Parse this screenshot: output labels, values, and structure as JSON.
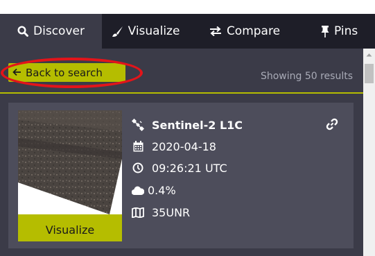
{
  "tabs": [
    {
      "label": "Discover",
      "icon": "search-icon",
      "active": true
    },
    {
      "label": "Visualize",
      "icon": "brush-icon",
      "active": false
    },
    {
      "label": "Compare",
      "icon": "swap-arrows-icon",
      "active": false
    },
    {
      "label": "Pins",
      "icon": "pin-icon",
      "active": false
    }
  ],
  "results": {
    "back_label": "Back to search",
    "count_text": "Showing 50 results"
  },
  "card": {
    "satellite": "Sentinel-2 L1C",
    "date": "2020-04-18",
    "time": "09:26:21 UTC",
    "cloud_cover": "0.4%",
    "tile": "35UNR",
    "visualize_label": "Visualize"
  },
  "colors": {
    "accent": "#b5bd00",
    "tab_bar": "#1e1e28",
    "panel": "#3b3b48",
    "card": "#4d4d5b",
    "highlight": "#e3141a"
  }
}
